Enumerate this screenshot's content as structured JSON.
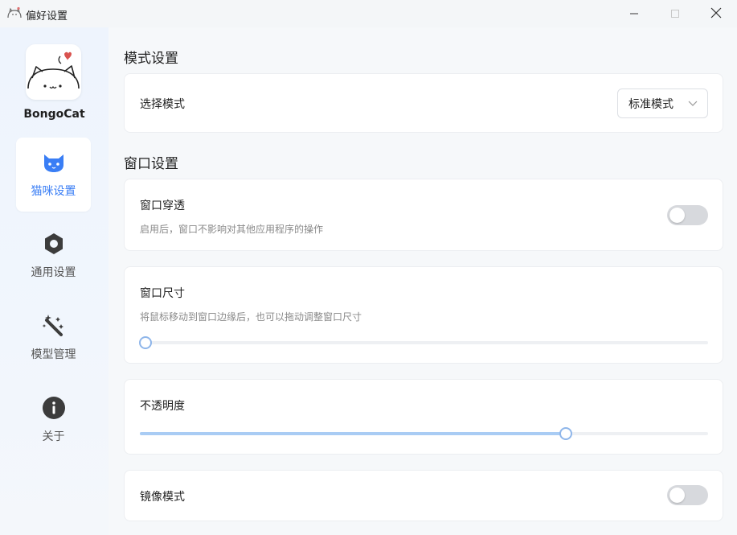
{
  "window": {
    "title": "偏好设置",
    "app_icon": "bongocat-app-icon",
    "controls": [
      "minimize-icon",
      "maximize-icon",
      "close-icon"
    ]
  },
  "sidebar": {
    "brand": "BongoCat",
    "items": [
      {
        "id": "cat",
        "label": "猫咪设置",
        "icon": "cat-icon",
        "active": true
      },
      {
        "id": "general",
        "label": "通用设置",
        "icon": "hexagon-settings-icon",
        "active": false
      },
      {
        "id": "model",
        "label": "模型管理",
        "icon": "magic-wand-icon",
        "active": false
      },
      {
        "id": "about",
        "label": "关于",
        "icon": "info-icon",
        "active": false
      }
    ]
  },
  "main": {
    "mode_section": {
      "title": "模式设置",
      "select_mode": {
        "label": "选择模式",
        "value": "标准模式"
      }
    },
    "window_section": {
      "title": "窗口设置",
      "passthrough": {
        "label": "窗口穿透",
        "desc": "启用后，窗口不影响对其他应用程序的操作",
        "enabled": false
      },
      "size": {
        "label": "窗口尺寸",
        "desc": "将鼠标移动到窗口边缘后，也可以拖动调整窗口尺寸",
        "value_fraction": 0.0
      },
      "opacity": {
        "label": "不透明度",
        "value_fraction": 0.75
      },
      "mirror": {
        "label": "镜像模式",
        "enabled": false
      }
    }
  },
  "colors": {
    "accent": "#3a7ef5",
    "toggle_off": "#d7d9dd",
    "slider_fill": "#a9ccf4",
    "slider_thumb_border": "#8fb6ea"
  }
}
